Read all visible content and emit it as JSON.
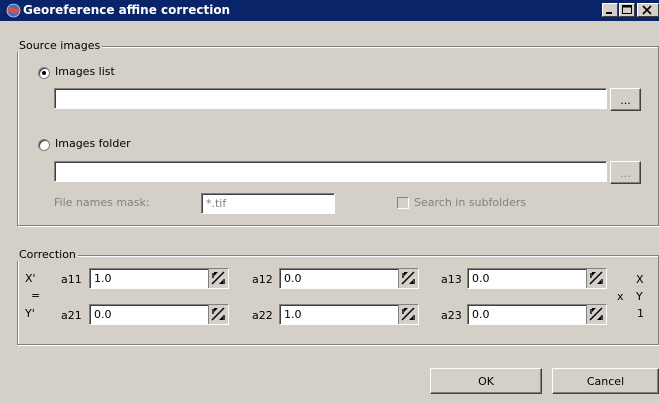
{
  "window": {
    "title": "Georeference affine correction"
  },
  "source_images": {
    "group_label": "Source images",
    "images_list": {
      "label": "Images list",
      "selected": true,
      "path_value": "",
      "browse_label": "..."
    },
    "images_folder": {
      "label": "Images folder",
      "selected": false,
      "path_value": "",
      "browse_label": "..."
    },
    "mask": {
      "label": "File names mask:",
      "value": "*.tif"
    },
    "subfolders": {
      "label": "Search in subfolders",
      "checked": false
    }
  },
  "correction": {
    "group_label": "Correction",
    "x_prime": "X'",
    "y_prime": "Y'",
    "equals": "=",
    "times": "x",
    "vector": [
      "X",
      "Y",
      "1"
    ],
    "coefficients": [
      {
        "name": "a11",
        "value": "1.0"
      },
      {
        "name": "a12",
        "value": "0.0"
      },
      {
        "name": "a13",
        "value": "0.0"
      },
      {
        "name": "a21",
        "value": "0.0"
      },
      {
        "name": "a22",
        "value": "1.0"
      },
      {
        "name": "a23",
        "value": "0.0"
      }
    ]
  },
  "buttons": {
    "ok": "OK",
    "cancel": "Cancel"
  },
  "colors": {
    "titlebar": "#0a246a",
    "face": "#d4d0c8",
    "shadow": "#808080",
    "field": "#ffffff"
  }
}
